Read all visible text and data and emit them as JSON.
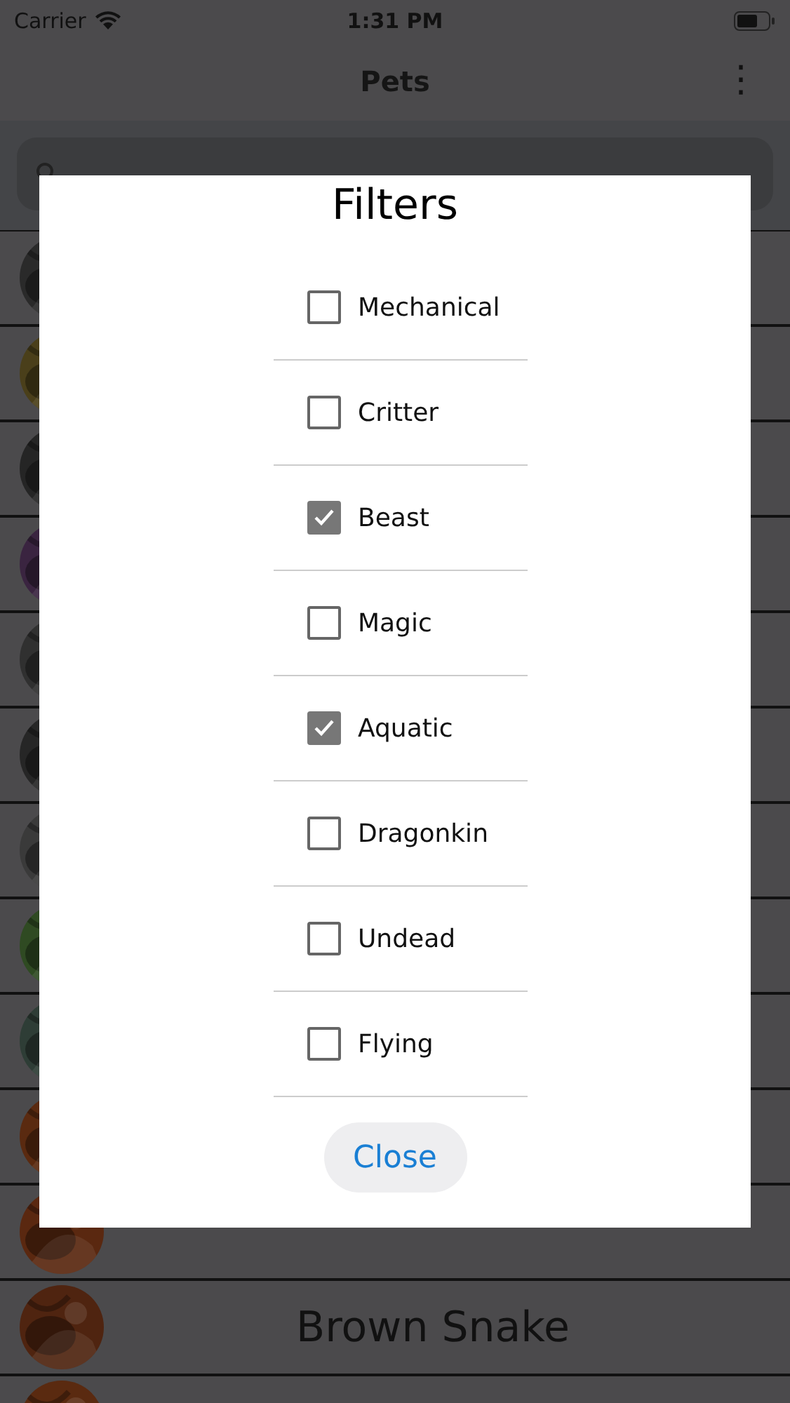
{
  "status_bar": {
    "carrier": "Carrier",
    "time": "1:31 PM"
  },
  "nav": {
    "title": "Pets",
    "menu": "⋮"
  },
  "rows": [
    {
      "kind": "picture"
    },
    {
      "kind": "picture"
    },
    {
      "kind": "picture"
    },
    {
      "kind": "picture"
    },
    {
      "kind": "picture"
    },
    {
      "kind": "picture"
    },
    {
      "kind": "picture"
    },
    {
      "kind": "picture"
    },
    {
      "kind": "picture"
    },
    {
      "kind": "picture"
    },
    {
      "kind": "picture"
    },
    {
      "kind": "picture",
      "name": "Brown Snake"
    },
    {
      "kind": "picture"
    }
  ],
  "dialog": {
    "title": "Filters",
    "filters": [
      {
        "label": "Mechanical",
        "checked": false
      },
      {
        "label": "Critter",
        "checked": false
      },
      {
        "label": "Beast",
        "checked": true
      },
      {
        "label": "Magic",
        "checked": false
      },
      {
        "label": "Aquatic",
        "checked": true
      },
      {
        "label": "Dragonkin",
        "checked": false
      },
      {
        "label": "Undead",
        "checked": false
      },
      {
        "label": "Flying",
        "checked": false
      }
    ],
    "close": "Close"
  }
}
